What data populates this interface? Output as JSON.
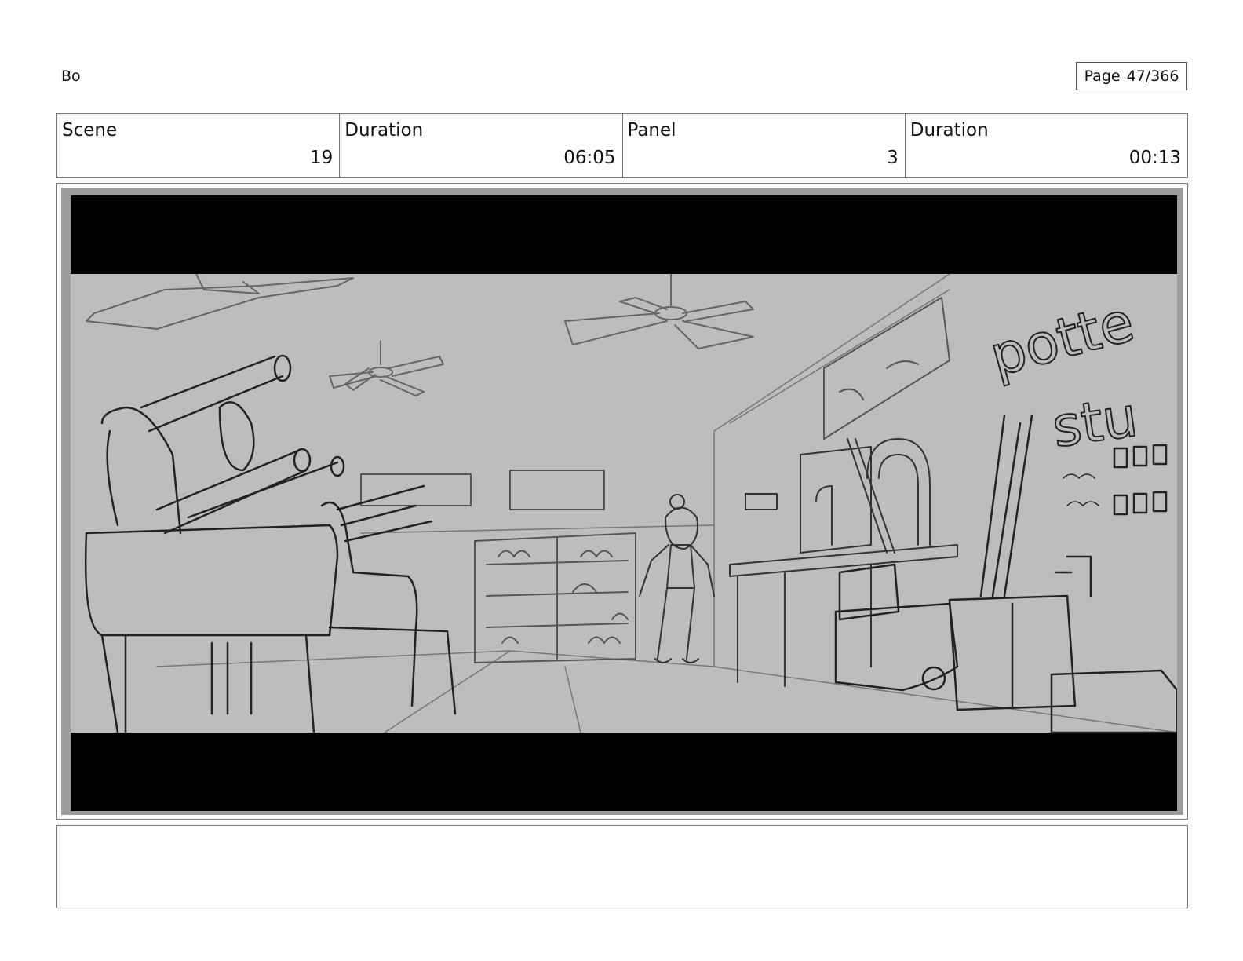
{
  "header": {
    "project_name": "Bo",
    "page_label": "Page",
    "page_number": "47/366"
  },
  "info": {
    "scene_label": "Scene",
    "scene_value": "19",
    "scene_duration_label": "Duration",
    "scene_duration_value": "06:05",
    "panel_label": "Panel",
    "panel_value": "3",
    "panel_duration_label": "Duration",
    "panel_duration_value": "00:13"
  },
  "panel_art": {
    "description_icon": "storyboard-sketch-pottery-studio-interior",
    "sign_text_1": "potte",
    "sign_text_2": "stu",
    "colors": {
      "letterbox": "#000000",
      "sketch_bg": "#bdbdbd"
    }
  },
  "notes": {
    "text": ""
  }
}
